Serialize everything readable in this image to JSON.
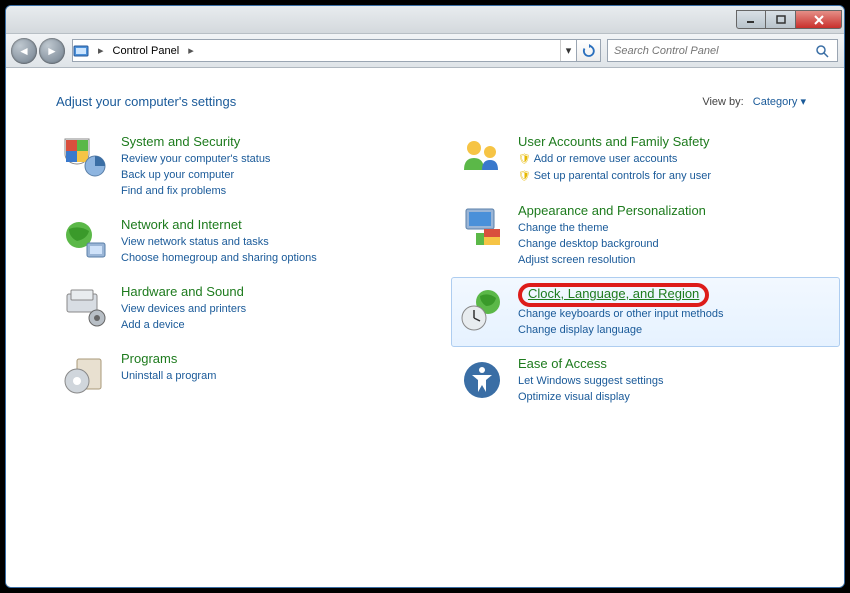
{
  "breadcrumb": {
    "location": "Control Panel"
  },
  "search": {
    "placeholder": "Search Control Panel"
  },
  "header": {
    "title": "Adjust your computer's settings",
    "viewby_label": "View by:",
    "viewby_value": "Category"
  },
  "left": [
    {
      "title": "System and Security",
      "subs": [
        "Review your computer's status",
        "Back up your computer",
        "Find and fix problems"
      ]
    },
    {
      "title": "Network and Internet",
      "subs": [
        "View network status and tasks",
        "Choose homegroup and sharing options"
      ]
    },
    {
      "title": "Hardware and Sound",
      "subs": [
        "View devices and printers",
        "Add a device"
      ]
    },
    {
      "title": "Programs",
      "subs": [
        "Uninstall a program"
      ]
    }
  ],
  "right": [
    {
      "title": "User Accounts and Family Safety",
      "subs": [
        "Add or remove user accounts",
        "Set up parental controls for any user"
      ],
      "shield": true
    },
    {
      "title": "Appearance and Personalization",
      "subs": [
        "Change the theme",
        "Change desktop background",
        "Adjust screen resolution"
      ]
    },
    {
      "title": "Clock, Language, and Region",
      "subs": [
        "Change keyboards or other input methods",
        "Change display language"
      ],
      "highlighted": true
    },
    {
      "title": "Ease of Access",
      "subs": [
        "Let Windows suggest settings",
        "Optimize visual display"
      ]
    }
  ]
}
